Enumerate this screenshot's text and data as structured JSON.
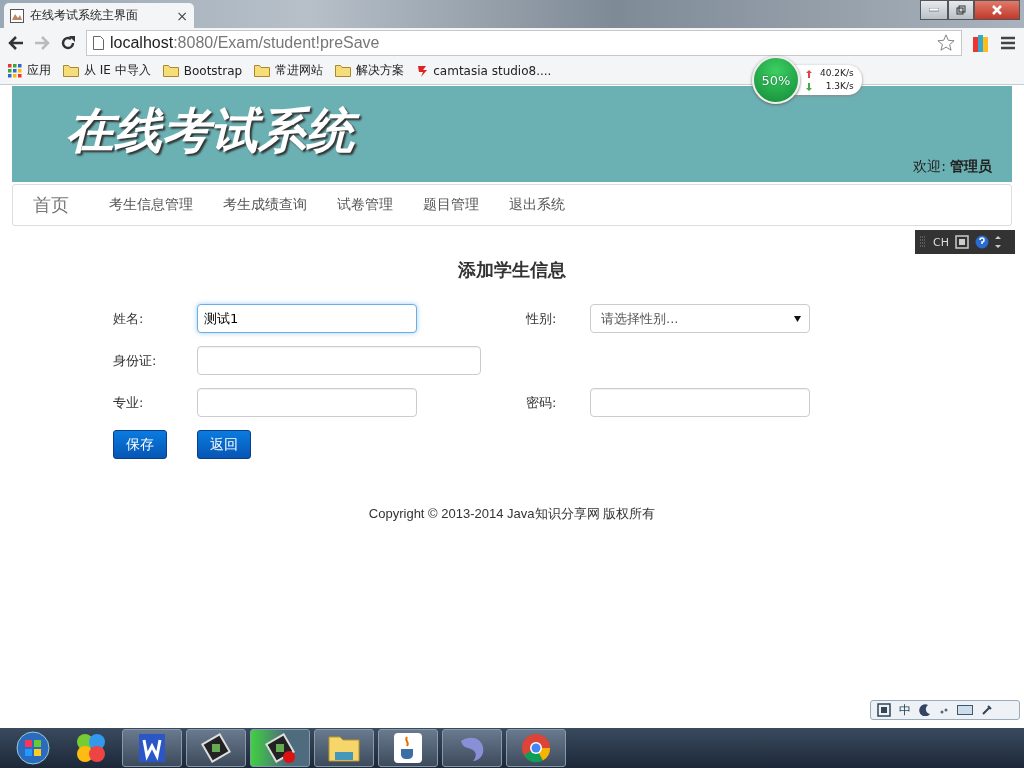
{
  "browser": {
    "tab_title": "在线考试系统主界面",
    "tab_close": "×",
    "url_host": "localhost",
    "url_path": ":8080/Exam/student!preSave",
    "bookmarks": [
      {
        "kind": "apps",
        "label": "应用"
      },
      {
        "kind": "folder",
        "label": "从 IE 中导入"
      },
      {
        "kind": "folder",
        "label": "Bootstrap"
      },
      {
        "kind": "folder",
        "label": "常进网站"
      },
      {
        "kind": "folder",
        "label": "解决方案"
      },
      {
        "kind": "site",
        "label": "camtasia studio8...."
      }
    ]
  },
  "net_meter": {
    "percent": "50%",
    "up": "40.2K/s",
    "down": "1.3K/s"
  },
  "header": {
    "title": "在线考试系统",
    "welcome_label": "欢迎:",
    "welcome_user": "管理员"
  },
  "nav": {
    "brand": "首页",
    "items": [
      "考生信息管理",
      "考生成绩查询",
      "试卷管理",
      "题目管理",
      "退出系统"
    ]
  },
  "ime_toolbar": {
    "label": "CH"
  },
  "form": {
    "title": "添加学生信息",
    "rows": [
      [
        {
          "kind": "text",
          "label": "姓名:",
          "value": "测试1",
          "focused": true
        },
        {
          "kind": "select",
          "label": "性别:",
          "placeholder": "请选择性别...",
          "focused": false
        }
      ],
      [
        {
          "kind": "text",
          "label": "身份证:",
          "focused": false
        }
      ],
      [
        {
          "kind": "text",
          "label": "专业:",
          "focused": false
        },
        {
          "kind": "password",
          "label": "密码:",
          "focused": false
        }
      ]
    ],
    "buttons": [
      "保存",
      "返回"
    ]
  },
  "footer": "Copyright © 2013-2014 Java知识分享网 版权所有",
  "ime_bar": {
    "label": "中"
  },
  "taskbar": {
    "items": [
      {
        "kind": "start"
      },
      {
        "kind": "pinwheel"
      },
      {
        "kind": "writer",
        "active": false
      },
      {
        "kind": "terminal",
        "active": false
      },
      {
        "kind": "terminal-alert",
        "active": true
      },
      {
        "kind": "folder",
        "active": false
      },
      {
        "kind": "java",
        "active": false
      },
      {
        "kind": "dolphin",
        "active": false
      },
      {
        "kind": "chrome",
        "active": false
      }
    ]
  }
}
